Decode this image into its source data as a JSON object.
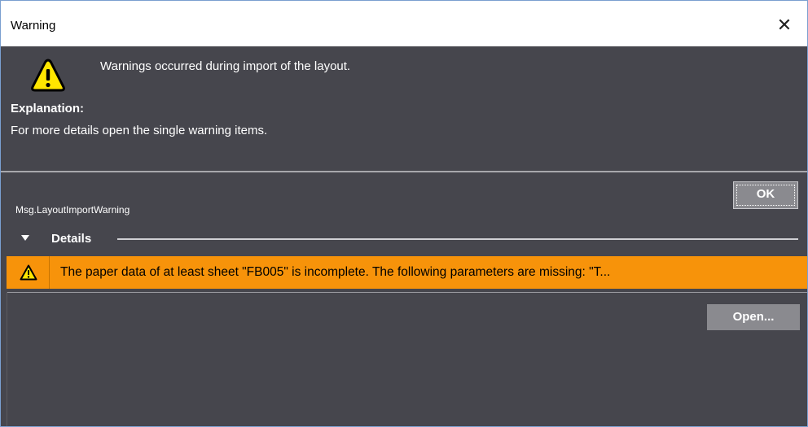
{
  "window": {
    "title": "Warning",
    "close_glyph": "✕"
  },
  "message": {
    "icon": "warning-triangle-icon",
    "headline": "Warnings occurred during import of the layout.",
    "explanation_title": "Explanation:",
    "explanation_text": "For more details open the single warning items."
  },
  "buttons": {
    "ok_label": "OK",
    "open_label": "Open..."
  },
  "message_id": "Msg.LayoutImportWarning",
  "details": {
    "label": "Details",
    "expanded": true,
    "items": [
      {
        "icon": "warning-triangle-icon",
        "text": "The paper data of at least sheet \"FB005\" is incomplete. The following parameters are missing: \"T..."
      }
    ]
  },
  "colors": {
    "dialog_bg": "#46464d",
    "warning_row_bg": "#f7930a",
    "button_bg": "#8a8a8f",
    "icon_yellow": "#ffe600"
  }
}
